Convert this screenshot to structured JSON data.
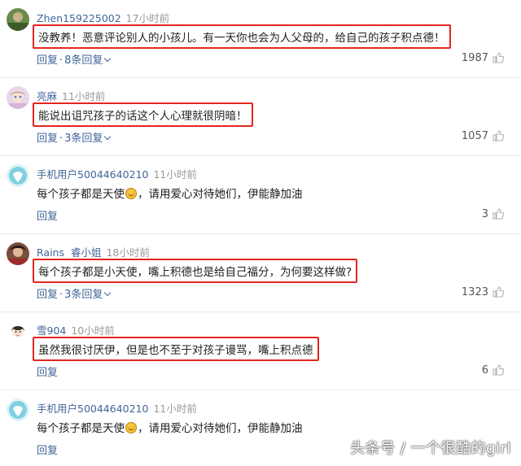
{
  "comments": [
    {
      "username": "Zhen159225002",
      "badge": "",
      "time": "17小时前",
      "text": "没教养！恶意评论别人的小孩儿。有一天你也会为人父母的，给自己的孩子积点德！",
      "reply_label": "回复",
      "replies_label": "8条回复",
      "likes": "1987",
      "highlighted": true
    },
    {
      "username": "亮麻",
      "badge": "",
      "time": "11小时前",
      "text": "能说出诅咒孩子的话这个人心理就很阴暗！",
      "reply_label": "回复",
      "replies_label": "3条回复",
      "likes": "1057",
      "highlighted": true
    },
    {
      "username": "手机用户50044640210",
      "badge": "",
      "time": "11小时前",
      "text_before": "每个孩子都是天使",
      "text_after": "，请用爱心对待她们，伊能静加油",
      "reply_label": "回复",
      "likes": "3",
      "highlighted": false
    },
    {
      "username": "Rains",
      "badge": "睿小姐",
      "time": "18小时前",
      "text": "每个孩子都是小天使，嘴上积德也是给自己福分，为何要这样做?",
      "reply_label": "回复",
      "replies_label": "3条回复",
      "likes": "1323",
      "highlighted": true
    },
    {
      "username": "雪904",
      "badge": "",
      "time": "10小时前",
      "text": "虽然我很讨厌伊，但是也不至于对孩子谩骂，嘴上积点德",
      "reply_label": "回复",
      "likes": "6",
      "highlighted": true
    },
    {
      "username": "手机用户50044640210",
      "badge": "",
      "time": "11小时前",
      "text_before": "每个孩子都是天使",
      "text_after": "，请用爱心对待她们，伊能静加油",
      "reply_label": "回复",
      "likes": "",
      "highlighted": false
    }
  ],
  "watermark": "头条号 / 一个很酷的girl",
  "colors": {
    "link": "#406599",
    "highlight_border": "#e3261e",
    "muted": "#999999"
  }
}
